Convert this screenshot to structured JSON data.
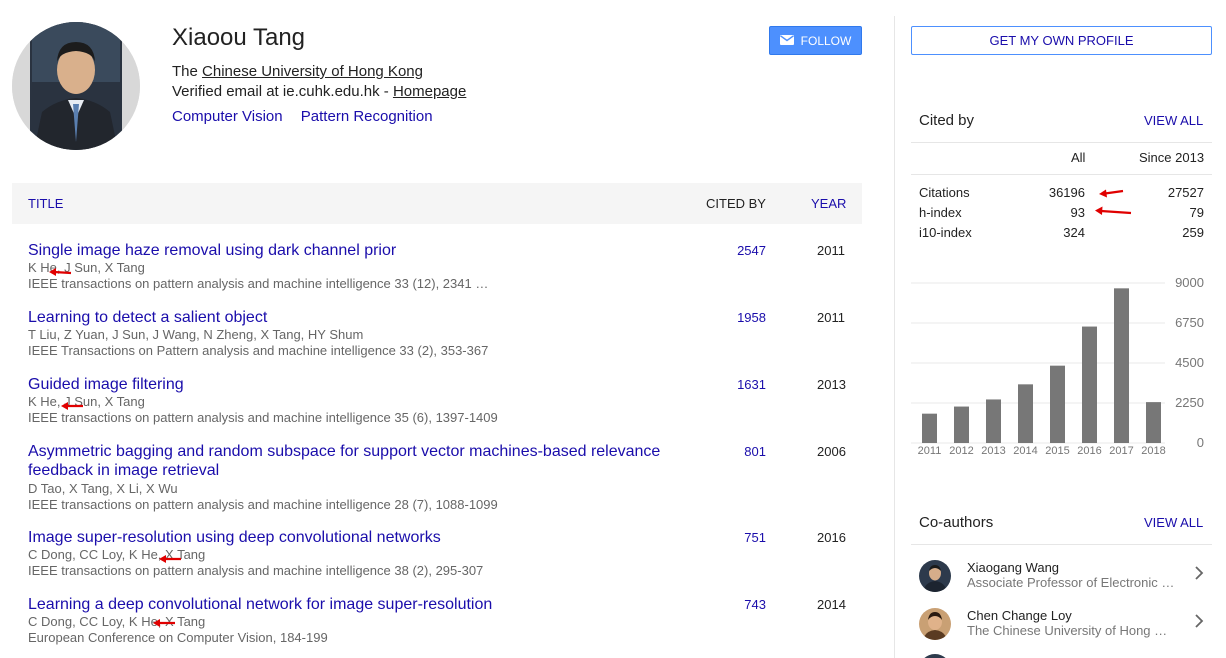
{
  "profile": {
    "name": "Xiaoou Tang",
    "affiliation_prefix": "The ",
    "affiliation_link": "Chinese University of Hong Kong",
    "email_text": "Verified email at ie.cuhk.edu.hk - ",
    "homepage_label": "Homepage",
    "interests": [
      "Computer Vision",
      "Pattern Recognition"
    ]
  },
  "follow_button": {
    "label": "FOLLOW",
    "icon": "envelope-icon"
  },
  "table": {
    "headers": {
      "title": "TITLE",
      "cited_by": "CITED BY",
      "year": "YEAR"
    },
    "rows": [
      {
        "title": "Single image haze removal using dark channel prior",
        "authors": "K He, J Sun, X Tang",
        "venue": "IEEE transactions on pattern analysis and machine intelligence 33 (12), 2341 …",
        "cited_by": "2547",
        "year": "2011"
      },
      {
        "title": "Learning to detect a salient object",
        "authors": "T Liu, Z Yuan, J Sun, J Wang, N Zheng, X Tang, HY Shum",
        "venue": "IEEE Transactions on Pattern analysis and machine intelligence 33 (2), 353-367",
        "cited_by": "1958",
        "year": "2011"
      },
      {
        "title": "Guided image filtering",
        "authors": "K He, J Sun, X Tang",
        "venue": "IEEE transactions on pattern analysis and machine intelligence 35 (6), 1397-1409",
        "cited_by": "1631",
        "year": "2013"
      },
      {
        "title": "Asymmetric bagging and random subspace for support vector machines-based relevance feedback in image retrieval",
        "authors": "D Tao, X Tang, X Li, X Wu",
        "venue": "IEEE transactions on pattern analysis and machine intelligence 28 (7), 1088-1099",
        "cited_by": "801",
        "year": "2006"
      },
      {
        "title": "Image super-resolution using deep convolutional networks",
        "authors": "C Dong, CC Loy, K He, X Tang",
        "venue": "IEEE transactions on pattern analysis and machine intelligence 38 (2), 295-307",
        "cited_by": "751",
        "year": "2016"
      },
      {
        "title": "Learning a deep convolutional network for image super-resolution",
        "authors": "C Dong, CC Loy, K He, X Tang",
        "venue": "European Conference on Computer Vision, 184-199",
        "cited_by": "743",
        "year": "2014"
      }
    ]
  },
  "sidebar": {
    "get_profile_label": "GET MY OWN PROFILE",
    "cited_by": {
      "title": "Cited by",
      "view_all": "VIEW ALL",
      "col_all": "All",
      "col_since": "Since 2013",
      "stats": [
        {
          "label": "Citations",
          "all": "36196",
          "since": "27527"
        },
        {
          "label": "h-index",
          "all": "93",
          "since": "79"
        },
        {
          "label": "i10-index",
          "all": "324",
          "since": "259"
        }
      ]
    },
    "coauthors": {
      "title": "Co-authors",
      "view_all": "VIEW ALL",
      "items": [
        {
          "name": "Xiaogang Wang",
          "affiliation": "Associate Professor of Electronic Engineering"
        },
        {
          "name": "Chen Change Loy",
          "affiliation": "The Chinese University of Hong Kong"
        }
      ]
    }
  },
  "annotation_color": "#e00000",
  "chart_data": {
    "type": "bar",
    "categories": [
      "2011",
      "2012",
      "2013",
      "2014",
      "2015",
      "2016",
      "2017",
      "2018"
    ],
    "values": [
      1650,
      2050,
      2450,
      3300,
      4350,
      6550,
      8700,
      2300
    ],
    "ylim": [
      0,
      9000
    ],
    "yticks": [
      "9000",
      "6750",
      "4500",
      "2250",
      "0"
    ],
    "bar_color": "#777777",
    "grid": true
  }
}
